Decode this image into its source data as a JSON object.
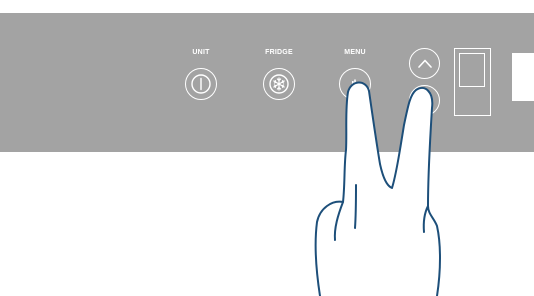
{
  "panel": {
    "buttons": [
      {
        "label": "UNIT",
        "icon": "power-icon"
      },
      {
        "label": "FRIDGE",
        "icon": "snowflake-icon"
      },
      {
        "label": "MENU",
        "icon": "menu-icon"
      }
    ],
    "arrow_up_icon": "chevron-up-icon",
    "arrow_down_icon": "chevron-down-icon",
    "colors": {
      "panel": "#a3a3a3",
      "line": "#ffffff",
      "hand_outline": "#1d4f7a"
    }
  },
  "gesture": {
    "icon": "two-finger-hand-icon"
  }
}
